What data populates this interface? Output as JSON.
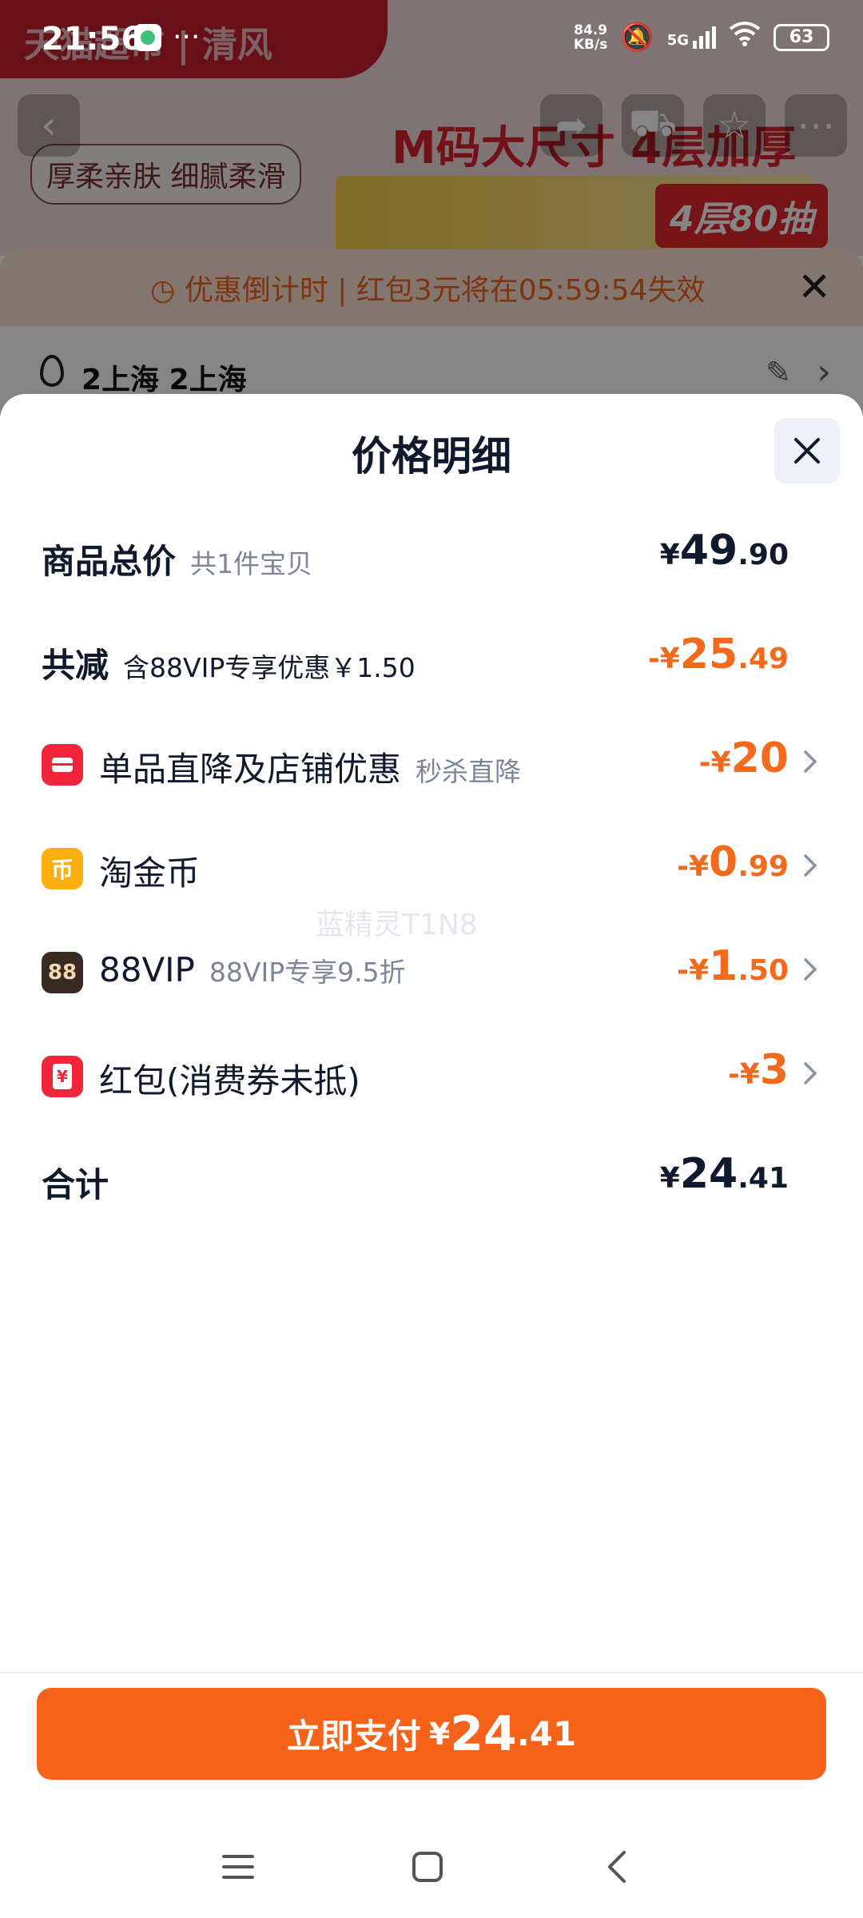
{
  "status_bar": {
    "time": "21:56",
    "dots": "···",
    "net_speed_value": "84.9",
    "net_speed_unit": "KB/s",
    "network": "5G",
    "battery": "63"
  },
  "background": {
    "brand_text": "天猫超市 | 清风",
    "headline": "M码大尺寸 4层加厚",
    "tag": "厚柔亲肤 细腻柔滑",
    "product_badge": "4层80抽",
    "notice": "优惠倒计时 | 红包3元将在05:59:54失效",
    "address": "2上海 2上海"
  },
  "sheet": {
    "title": "价格明细"
  },
  "rows": {
    "total": {
      "label": "商品总价",
      "sub": "共1件宝贝",
      "sign": "¥",
      "int": "49",
      "dec": ".90"
    },
    "reduce": {
      "label": "共减",
      "sub": "含88VIP专享优惠￥1.50",
      "sign": "-¥",
      "int": "25",
      "dec": ".49"
    },
    "store": {
      "label": "单品直降及店铺优惠",
      "sub": "秒杀直降",
      "sign": "-¥",
      "int": "20",
      "dec": ""
    },
    "coin": {
      "label": "淘金币",
      "icon_text": "币",
      "sign": "-¥",
      "int": "0",
      "dec": ".99"
    },
    "vip": {
      "label": "88VIP",
      "icon_text": "88",
      "sub": "88VIP专享9.5折",
      "sign": "-¥",
      "int": "1",
      "dec": ".50"
    },
    "redpacket": {
      "label": "红包(消费券未抵)",
      "icon_text": "¥",
      "sign": "-¥",
      "int": "3",
      "dec": ""
    },
    "sum": {
      "label": "合计",
      "sign": "¥",
      "int": "24",
      "dec": ".41"
    }
  },
  "watermark": "蓝精灵T1N8",
  "pay": {
    "label": "立即支付",
    "sign": "¥",
    "int": "24",
    "dec": ".41"
  },
  "colors": {
    "accent": "#f5631a",
    "discount": "#f36a1d",
    "text_primary": "#11192d",
    "text_secondary": "#7c8697"
  }
}
